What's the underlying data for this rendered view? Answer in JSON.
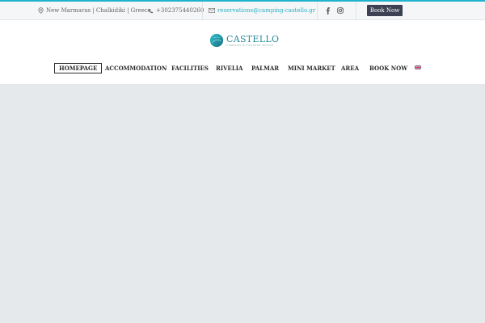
{
  "topbar": {
    "address": "New Marmaras | Chalkidiki | Greece",
    "phone": "+302375440260",
    "email": "reservations@camping-castello.gr",
    "social": [
      "facebook-icon",
      "instagram-icon"
    ],
    "book_button": "Book Now",
    "accent_color": "#1fb3cf"
  },
  "logo": {
    "name": "CASTELLO",
    "tagline": "CAMPING & COUNTRY HOUSE"
  },
  "nav": {
    "items": [
      {
        "label": "HOMEPAGE",
        "active": true
      },
      {
        "label": "ACCOMMODATION"
      },
      {
        "label": "FACILITIES"
      },
      {
        "label": "RIVELIA"
      },
      {
        "label": "PALMAR"
      },
      {
        "label": "MINI MARKET"
      },
      {
        "label": "AREA"
      },
      {
        "label": "BOOK NOW"
      }
    ],
    "language_icon": "uk-flag-icon"
  }
}
